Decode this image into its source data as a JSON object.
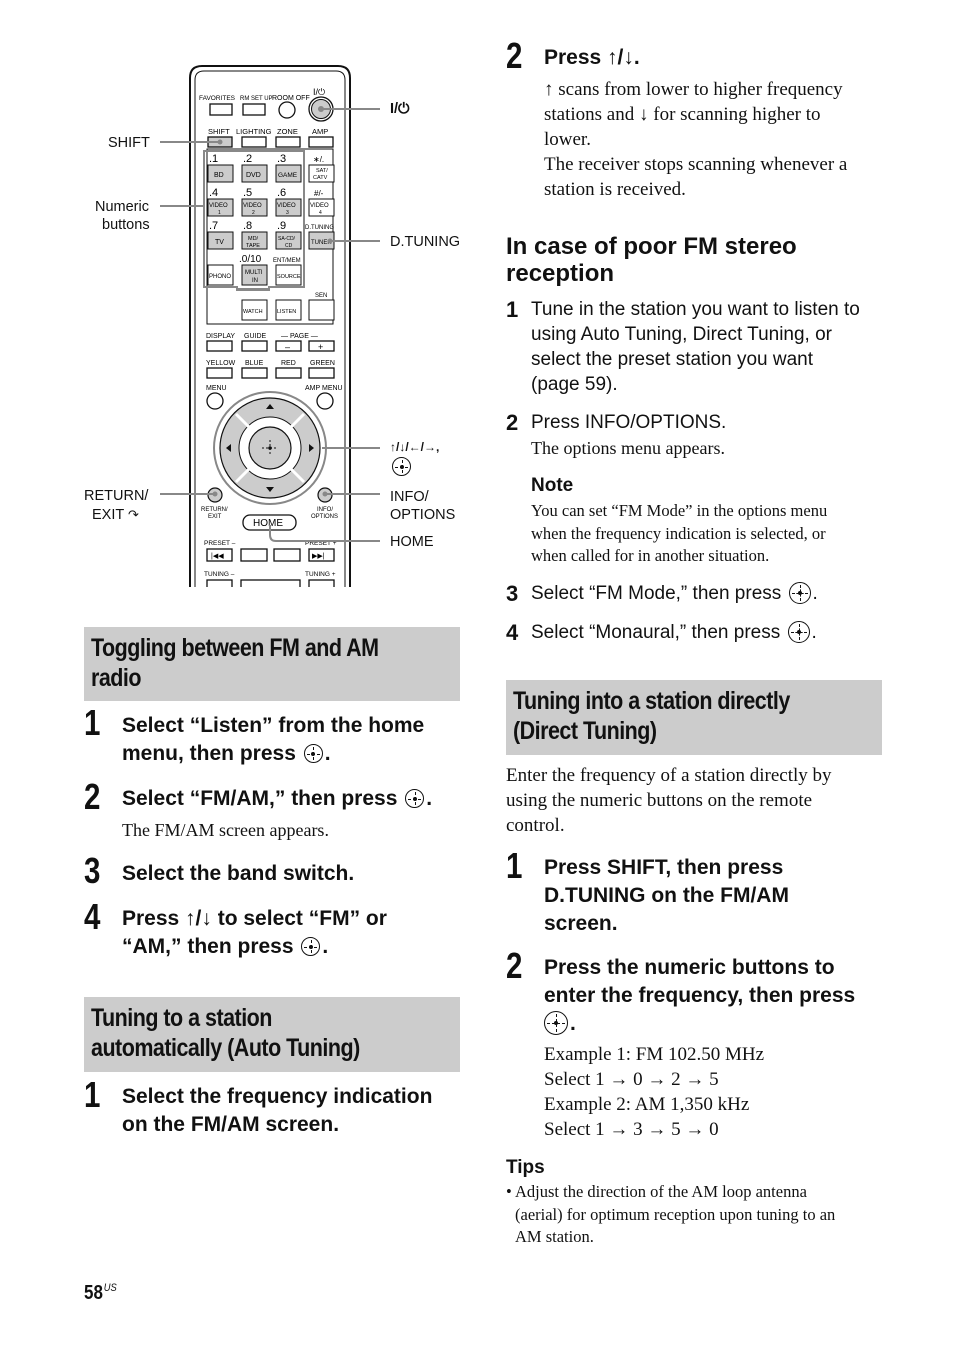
{
  "remote_diagram": {
    "callouts": {
      "shift": "SHIFT",
      "numeric_line1": "Numeric",
      "numeric_line2": "buttons",
      "return_line1": "RETURN/",
      "return_line2": "EXIT",
      "power": "I/⏻",
      "d_tuning": "D.TUNING",
      "arrows": "↑/↓/←/→,",
      "info_line1": "INFO/",
      "info_line2": "OPTIONS",
      "home": "HOME"
    },
    "buttons": {
      "favorites": "FAVORITES",
      "rm_set_up": "RM SET UP",
      "room_off": "ROOM OFF",
      "power": "I/⏻",
      "shift": "SHIFT",
      "lighting": "LIGHTING",
      "zone": "ZONE",
      "amp": "AMP",
      "n1": ".1",
      "n2": ".2",
      "n3": ".3",
      "star": "∗/.",
      "bd": "BD",
      "dvd": "DVD",
      "game": "GAME",
      "sat1": "SAT/",
      "sat2": "CATV",
      "n4": ".4",
      "n5": ".5",
      "n6": ".6",
      "hash": "#/-",
      "video1a": "VIDEO",
      "video1b": "1",
      "video2a": "VIDEO",
      "video2b": "2",
      "video3a": "VIDEO",
      "video3b": "3",
      "video4a": "VIDEO",
      "video4b": "4",
      "n7": ".7",
      "n8": ".8",
      "n9": ".9",
      "dtuning": "D.TUNING",
      "tv": "TV",
      "md1": "MD/",
      "md2": "TAPE",
      "sacd1": "SA-CD/",
      "sacd2": "CD",
      "tuner": "TUNER",
      "n0": ".0/10",
      "entmem": "ENT/MEM",
      "phono": "PHONO",
      "multi1": "MULTI",
      "multi2": "IN",
      "source": "SOURCE",
      "sen": "SEN",
      "watch": "WATCH",
      "listen": "LISTEN",
      "display": "DISPLAY",
      "guide": "GUIDE",
      "page": "— PAGE —",
      "minus": "–",
      "plus": "+",
      "yellow": "YELLOW",
      "blue": "BLUE",
      "red": "RED",
      "green": "GREEN",
      "menu": "MENU",
      "amp_menu": "AMP MENU",
      "return1": "RETURN/",
      "return2": "EXIT",
      "info1": "INFO/",
      "info2": "OPTIONS",
      "home": "HOME",
      "preset_minus": "PRESET –",
      "preset_plus": "PRESET +",
      "tuning_minus": "TUNING –",
      "tuning_plus": "TUNING +"
    }
  },
  "left": {
    "toggle_section": {
      "title_line1": "Toggling between FM and AM",
      "title_line2": "radio",
      "steps": [
        {
          "num": "1",
          "line1": "Select “Listen” from the home",
          "line2": "menu, then press",
          "line2_end": "."
        },
        {
          "num": "2",
          "line1": "Select “FM/AM,” then press",
          "line1_end": ".",
          "detail": "The FM/AM screen appears."
        },
        {
          "num": "3",
          "line1": "Select the band switch."
        },
        {
          "num": "4",
          "line1": "Press ↑/↓ to select “FM” or",
          "line2": "“AM,” then press",
          "line2_end": "."
        }
      ]
    },
    "auto_section": {
      "title_line1": "Tuning to a station",
      "title_line2": "automatically (Auto Tuning)",
      "steps": [
        {
          "num": "1",
          "line1": "Select the frequency indication",
          "line2": "on the FM/AM screen."
        }
      ]
    },
    "page_number": "58",
    "page_suffix": "US"
  },
  "right": {
    "auto_step2": {
      "num": "2",
      "title": "Press ↑/↓.",
      "body": [
        "↑ scans from lower to higher frequency",
        "stations and ↓ for scanning higher to",
        "lower.",
        "The receiver stops scanning whenever a",
        "station is received."
      ]
    },
    "poor_reception": {
      "title_line1": "In case of poor FM stereo",
      "title_line2": "reception",
      "steps": [
        {
          "num": "1",
          "lines": [
            "Tune in the station you want to listen to",
            "using Auto Tuning, Direct Tuning, or",
            "select the preset station you want",
            "(page 59)."
          ]
        },
        {
          "num": "2",
          "lines": [
            "Press INFO/OPTIONS."
          ],
          "detail": "The options menu appears."
        },
        {
          "num": "3",
          "lines": [
            "Select “FM Mode,” then press"
          ],
          "end": "."
        },
        {
          "num": "4",
          "lines": [
            "Select “Monaural,” then press"
          ],
          "end": "."
        }
      ],
      "note": {
        "heading": "Note",
        "lines": [
          "You can set “FM Mode” in the options menu",
          "when the frequency indication is selected, or",
          "when called for in another situation."
        ]
      }
    },
    "direct_section": {
      "title_line1": "Tuning into a station directly",
      "title_line2": "(Direct Tuning)",
      "intro": [
        "Enter the frequency of a station directly by",
        "using the numeric buttons on the remote",
        "control."
      ],
      "steps": [
        {
          "num": "1",
          "lines": [
            "Press SHIFT, then press",
            "D.TUNING on the FM/AM",
            "screen."
          ]
        },
        {
          "num": "2",
          "lines": [
            "Press the numeric buttons to",
            "enter the frequency, then press"
          ],
          "end": "."
        }
      ],
      "examples": [
        "Example 1: FM 102.50 MHz",
        "Select 1 → 0 → 2 → 5",
        "Example 2: AM 1,350 kHz",
        "Select 1 → 3 → 5 → 0"
      ],
      "tips": {
        "heading": "Tips",
        "lines": [
          "• Adjust the direction of the AM loop antenna",
          "(aerial) for optimum reception upon tuning to an",
          "AM station."
        ]
      }
    }
  }
}
